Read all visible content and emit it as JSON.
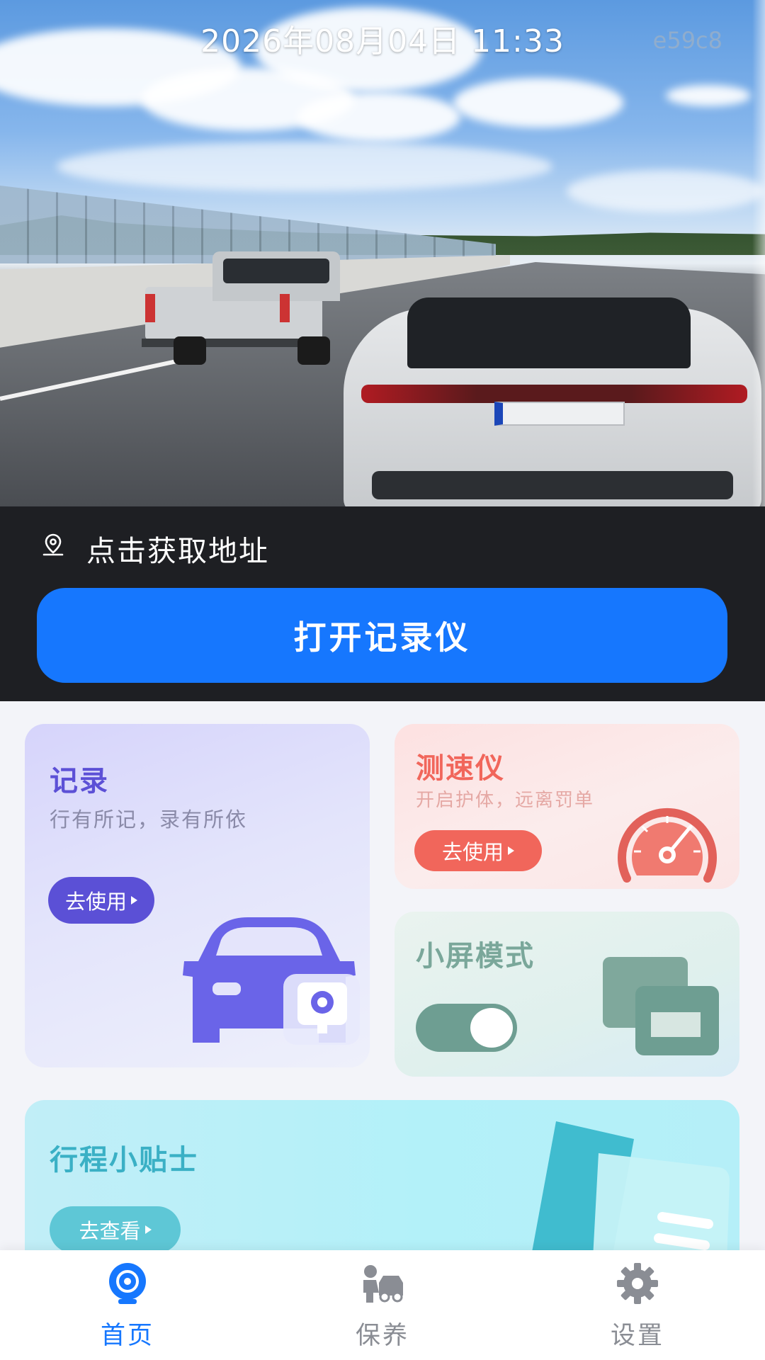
{
  "preview": {
    "datetime": "2026年08月04日 11:33",
    "watermark": "e59c8"
  },
  "location": {
    "icon": "location-pin-icon",
    "text": "点击获取地址"
  },
  "primary_button": {
    "label": "打开记录仪"
  },
  "cards": {
    "record": {
      "title": "记录",
      "subtitle": "行有所记，录有所依",
      "button": "去使用",
      "icon": "car-camera-icon",
      "accent": "#5c50d6"
    },
    "speedometer": {
      "title": "测速仪",
      "subtitle": "开启护体，远离罚单",
      "button": "去使用",
      "icon": "speedometer-icon",
      "accent": "#f1665b"
    },
    "mini_screen": {
      "title": "小屏模式",
      "toggle_on": true,
      "icon": "overlapping-windows-icon",
      "accent": "#6e9e92"
    },
    "tips": {
      "title": "行程小贴士",
      "button": "去查看",
      "icon": "book-icon",
      "accent": "#46c0d3"
    }
  },
  "nav": {
    "active": "home",
    "items": [
      {
        "id": "home",
        "label": "首页",
        "icon": "camera-icon"
      },
      {
        "id": "maintenance",
        "label": "保养",
        "icon": "car-repair-icon"
      },
      {
        "id": "settings",
        "label": "设置",
        "icon": "gear-icon"
      }
    ],
    "active_color": "#1677fe",
    "inactive_color": "#8a8d94"
  }
}
